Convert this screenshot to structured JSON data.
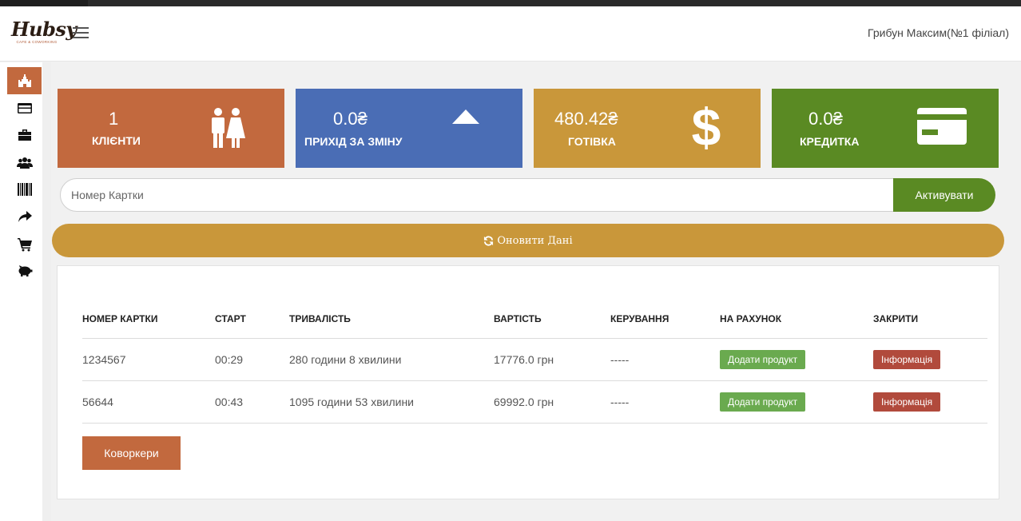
{
  "header": {
    "logo_text": "Hubsy",
    "logo_sub": "CAFE & COWORKING",
    "user": "Грибун Максим(№1 філіал)"
  },
  "sidebar": {
    "items": [
      {
        "icon": "castle-icon",
        "active": true
      },
      {
        "icon": "credit-card-icon",
        "active": false
      },
      {
        "icon": "briefcase-icon",
        "active": false
      },
      {
        "icon": "users-icon",
        "active": false
      },
      {
        "icon": "barcode-icon",
        "active": false
      },
      {
        "icon": "share-arrow-icon",
        "active": false
      },
      {
        "icon": "cart-icon",
        "active": false
      },
      {
        "icon": "piggy-bank-icon",
        "active": false
      }
    ]
  },
  "stats": [
    {
      "value": "1",
      "label": "КЛІЄНТИ",
      "icon": "people-icon",
      "color": "#c2693e"
    },
    {
      "value": "0.0₴",
      "label": "ПРИХІД ЗА ЗМІНУ",
      "icon": "triangle-up-icon",
      "color": "#4a6db5"
    },
    {
      "value": "480.42₴",
      "label": "ГОТІВКА",
      "icon": "dollar-icon",
      "color": "#c9973a"
    },
    {
      "value": "0.0₴",
      "label": "КРЕДИТКА",
      "icon": "credit-card-icon",
      "color": "#5a8a23"
    }
  ],
  "search": {
    "placeholder": "Номер Картки",
    "button": "Активувати"
  },
  "refresh": {
    "label": "Оновити Дані"
  },
  "table": {
    "headers": [
      "НОМЕР КАРТКИ",
      "СТАРТ",
      "ТРИВАЛІСТЬ",
      "ВАРТІСТЬ",
      "КЕРУВАННЯ",
      "НА РАХУНОК",
      "ЗАКРИТИ"
    ],
    "rows": [
      {
        "card": "1234567",
        "start": "00:29",
        "duration": "280 години 8 хвилини",
        "cost": "17776.0 грн",
        "control": "-----",
        "account": "Додати продукт",
        "close": "Інформація"
      },
      {
        "card": "56644",
        "start": "00:43",
        "duration": "1095 години 53 хвилини",
        "cost": "69992.0 грн",
        "control": "-----",
        "account": "Додати продукт",
        "close": "Інформація"
      }
    ]
  },
  "coworkers_button": "Коворкери"
}
